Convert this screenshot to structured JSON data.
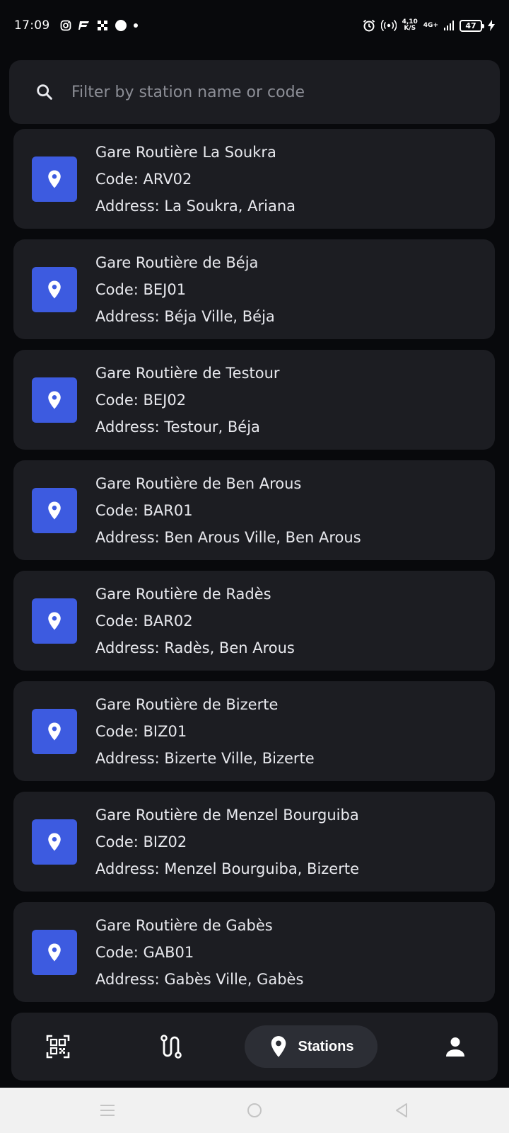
{
  "status_bar": {
    "time": "17:09",
    "speed": "4,10\nK/S",
    "network": "4G+",
    "battery": "47"
  },
  "search": {
    "placeholder": "Filter by station name or code",
    "value": "",
    "icon": "search-icon"
  },
  "stations": [
    {
      "name": "Gare Routière La Soukra",
      "code": "Code: ARV02",
      "address": "Address: La Soukra, Ariana"
    },
    {
      "name": "Gare Routière de Béja",
      "code": "Code: BEJ01",
      "address": "Address: Béja Ville, Béja"
    },
    {
      "name": "Gare Routière de Testour",
      "code": "Code: BEJ02",
      "address": "Address: Testour, Béja"
    },
    {
      "name": "Gare Routière de Ben Arous",
      "code": "Code: BAR01",
      "address": "Address: Ben Arous Ville, Ben Arous"
    },
    {
      "name": "Gare Routière de Radès",
      "code": "Code: BAR02",
      "address": "Address: Radès, Ben Arous"
    },
    {
      "name": "Gare Routière de Bizerte",
      "code": "Code: BIZ01",
      "address": "Address: Bizerte Ville, Bizerte"
    },
    {
      "name": "Gare Routière de Menzel Bourguiba",
      "code": "Code: BIZ02",
      "address": "Address: Menzel Bourguiba, Bizerte"
    },
    {
      "name": "Gare Routière de Gabès",
      "code": "Code: GAB01",
      "address": "Address: Gabès Ville, Gabès"
    }
  ],
  "bottom_nav": {
    "items": [
      {
        "icon": "qr-scan-icon"
      },
      {
        "icon": "route-icon"
      },
      {
        "icon": "location-pin-icon",
        "label": "Stations",
        "active": true
      },
      {
        "icon": "person-icon"
      }
    ]
  },
  "colors": {
    "background": "#08090c",
    "card": "#1c1d22",
    "accent": "#3d5be0",
    "active_pill": "#2c2e35"
  }
}
